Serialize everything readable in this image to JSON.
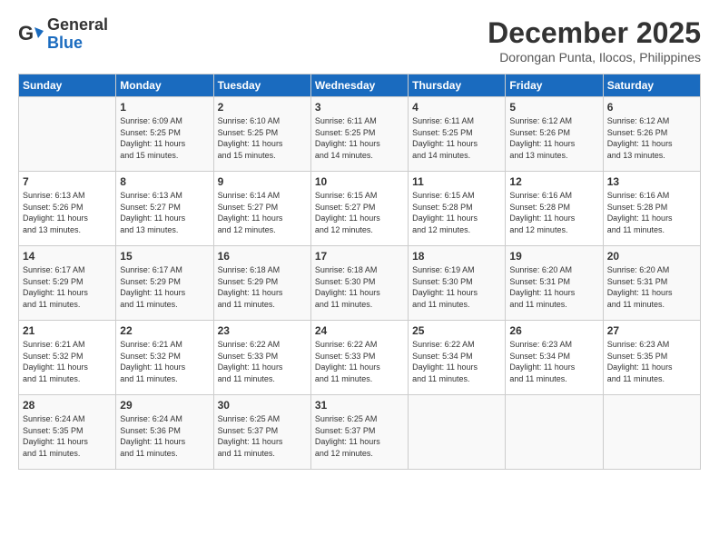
{
  "header": {
    "logo_general": "General",
    "logo_blue": "Blue",
    "month_year": "December 2025",
    "location": "Dorongan Punta, Ilocos, Philippines"
  },
  "calendar": {
    "headers": [
      "Sunday",
      "Monday",
      "Tuesday",
      "Wednesday",
      "Thursday",
      "Friday",
      "Saturday"
    ],
    "rows": [
      [
        {
          "day": "",
          "lines": []
        },
        {
          "day": "1",
          "lines": [
            "Sunrise: 6:09 AM",
            "Sunset: 5:25 PM",
            "Daylight: 11 hours",
            "and 15 minutes."
          ]
        },
        {
          "day": "2",
          "lines": [
            "Sunrise: 6:10 AM",
            "Sunset: 5:25 PM",
            "Daylight: 11 hours",
            "and 15 minutes."
          ]
        },
        {
          "day": "3",
          "lines": [
            "Sunrise: 6:11 AM",
            "Sunset: 5:25 PM",
            "Daylight: 11 hours",
            "and 14 minutes."
          ]
        },
        {
          "day": "4",
          "lines": [
            "Sunrise: 6:11 AM",
            "Sunset: 5:25 PM",
            "Daylight: 11 hours",
            "and 14 minutes."
          ]
        },
        {
          "day": "5",
          "lines": [
            "Sunrise: 6:12 AM",
            "Sunset: 5:26 PM",
            "Daylight: 11 hours",
            "and 13 minutes."
          ]
        },
        {
          "day": "6",
          "lines": [
            "Sunrise: 6:12 AM",
            "Sunset: 5:26 PM",
            "Daylight: 11 hours",
            "and 13 minutes."
          ]
        }
      ],
      [
        {
          "day": "7",
          "lines": [
            "Sunrise: 6:13 AM",
            "Sunset: 5:26 PM",
            "Daylight: 11 hours",
            "and 13 minutes."
          ]
        },
        {
          "day": "8",
          "lines": [
            "Sunrise: 6:13 AM",
            "Sunset: 5:27 PM",
            "Daylight: 11 hours",
            "and 13 minutes."
          ]
        },
        {
          "day": "9",
          "lines": [
            "Sunrise: 6:14 AM",
            "Sunset: 5:27 PM",
            "Daylight: 11 hours",
            "and 12 minutes."
          ]
        },
        {
          "day": "10",
          "lines": [
            "Sunrise: 6:15 AM",
            "Sunset: 5:27 PM",
            "Daylight: 11 hours",
            "and 12 minutes."
          ]
        },
        {
          "day": "11",
          "lines": [
            "Sunrise: 6:15 AM",
            "Sunset: 5:28 PM",
            "Daylight: 11 hours",
            "and 12 minutes."
          ]
        },
        {
          "day": "12",
          "lines": [
            "Sunrise: 6:16 AM",
            "Sunset: 5:28 PM",
            "Daylight: 11 hours",
            "and 12 minutes."
          ]
        },
        {
          "day": "13",
          "lines": [
            "Sunrise: 6:16 AM",
            "Sunset: 5:28 PM",
            "Daylight: 11 hours",
            "and 11 minutes."
          ]
        }
      ],
      [
        {
          "day": "14",
          "lines": [
            "Sunrise: 6:17 AM",
            "Sunset: 5:29 PM",
            "Daylight: 11 hours",
            "and 11 minutes."
          ]
        },
        {
          "day": "15",
          "lines": [
            "Sunrise: 6:17 AM",
            "Sunset: 5:29 PM",
            "Daylight: 11 hours",
            "and 11 minutes."
          ]
        },
        {
          "day": "16",
          "lines": [
            "Sunrise: 6:18 AM",
            "Sunset: 5:29 PM",
            "Daylight: 11 hours",
            "and 11 minutes."
          ]
        },
        {
          "day": "17",
          "lines": [
            "Sunrise: 6:18 AM",
            "Sunset: 5:30 PM",
            "Daylight: 11 hours",
            "and 11 minutes."
          ]
        },
        {
          "day": "18",
          "lines": [
            "Sunrise: 6:19 AM",
            "Sunset: 5:30 PM",
            "Daylight: 11 hours",
            "and 11 minutes."
          ]
        },
        {
          "day": "19",
          "lines": [
            "Sunrise: 6:20 AM",
            "Sunset: 5:31 PM",
            "Daylight: 11 hours",
            "and 11 minutes."
          ]
        },
        {
          "day": "20",
          "lines": [
            "Sunrise: 6:20 AM",
            "Sunset: 5:31 PM",
            "Daylight: 11 hours",
            "and 11 minutes."
          ]
        }
      ],
      [
        {
          "day": "21",
          "lines": [
            "Sunrise: 6:21 AM",
            "Sunset: 5:32 PM",
            "Daylight: 11 hours",
            "and 11 minutes."
          ]
        },
        {
          "day": "22",
          "lines": [
            "Sunrise: 6:21 AM",
            "Sunset: 5:32 PM",
            "Daylight: 11 hours",
            "and 11 minutes."
          ]
        },
        {
          "day": "23",
          "lines": [
            "Sunrise: 6:22 AM",
            "Sunset: 5:33 PM",
            "Daylight: 11 hours",
            "and 11 minutes."
          ]
        },
        {
          "day": "24",
          "lines": [
            "Sunrise: 6:22 AM",
            "Sunset: 5:33 PM",
            "Daylight: 11 hours",
            "and 11 minutes."
          ]
        },
        {
          "day": "25",
          "lines": [
            "Sunrise: 6:22 AM",
            "Sunset: 5:34 PM",
            "Daylight: 11 hours",
            "and 11 minutes."
          ]
        },
        {
          "day": "26",
          "lines": [
            "Sunrise: 6:23 AM",
            "Sunset: 5:34 PM",
            "Daylight: 11 hours",
            "and 11 minutes."
          ]
        },
        {
          "day": "27",
          "lines": [
            "Sunrise: 6:23 AM",
            "Sunset: 5:35 PM",
            "Daylight: 11 hours",
            "and 11 minutes."
          ]
        }
      ],
      [
        {
          "day": "28",
          "lines": [
            "Sunrise: 6:24 AM",
            "Sunset: 5:35 PM",
            "Daylight: 11 hours",
            "and 11 minutes."
          ]
        },
        {
          "day": "29",
          "lines": [
            "Sunrise: 6:24 AM",
            "Sunset: 5:36 PM",
            "Daylight: 11 hours",
            "and 11 minutes."
          ]
        },
        {
          "day": "30",
          "lines": [
            "Sunrise: 6:25 AM",
            "Sunset: 5:37 PM",
            "Daylight: 11 hours",
            "and 11 minutes."
          ]
        },
        {
          "day": "31",
          "lines": [
            "Sunrise: 6:25 AM",
            "Sunset: 5:37 PM",
            "Daylight: 11 hours",
            "and 12 minutes."
          ]
        },
        {
          "day": "",
          "lines": []
        },
        {
          "day": "",
          "lines": []
        },
        {
          "day": "",
          "lines": []
        }
      ]
    ]
  }
}
